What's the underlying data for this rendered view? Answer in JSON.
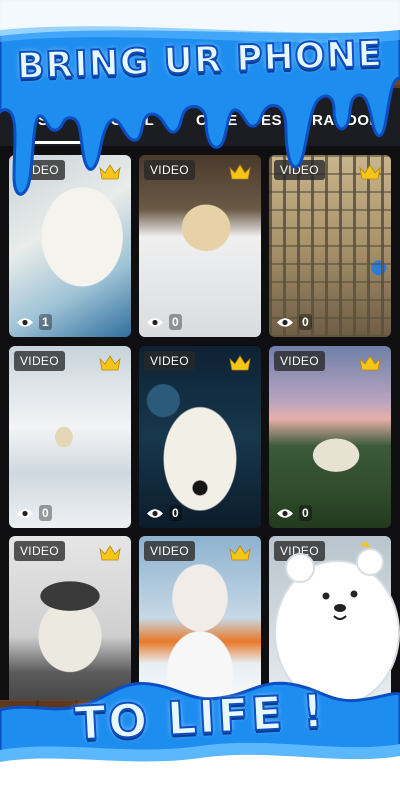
{
  "promo": {
    "headline_top": "BRING UR PHONE",
    "headline_bottom": "TO LIFE !"
  },
  "tabs": [
    {
      "label": "ST",
      "active": true
    },
    {
      "label": "POPUL",
      "active": false
    },
    {
      "label": "CATE",
      "active": false
    },
    {
      "label": "ES",
      "active": false
    },
    {
      "label": "RANDOM",
      "active": false
    }
  ],
  "cards": [
    {
      "badge": "VIDEO",
      "premium": true,
      "views": "1",
      "icon": "eye-icon"
    },
    {
      "badge": "VIDEO",
      "premium": true,
      "views": "0",
      "icon": "eye-icon"
    },
    {
      "badge": "VIDEO",
      "premium": true,
      "views": "0",
      "icon": "eye-icon"
    },
    {
      "badge": "VIDEO",
      "premium": true,
      "views": "0",
      "icon": "eye-icon"
    },
    {
      "badge": "VIDEO",
      "premium": true,
      "views": "0",
      "icon": "eye-icon"
    },
    {
      "badge": "VIDEO",
      "premium": true,
      "views": "0",
      "icon": "eye-icon"
    },
    {
      "badge": "VIDEO",
      "premium": true,
      "views": null,
      "icon": "eye-icon"
    },
    {
      "badge": "VIDEO",
      "premium": true,
      "views": null,
      "icon": "eye-icon"
    },
    {
      "badge": "VIDEO",
      "premium": true,
      "views": null,
      "icon": "eye-icon"
    }
  ],
  "colors": {
    "paint_blue": "#1d8df0",
    "paint_dark": "#0b4fc2",
    "crown_gold": "#f5c518",
    "tab_bar": "#1c1d22"
  }
}
